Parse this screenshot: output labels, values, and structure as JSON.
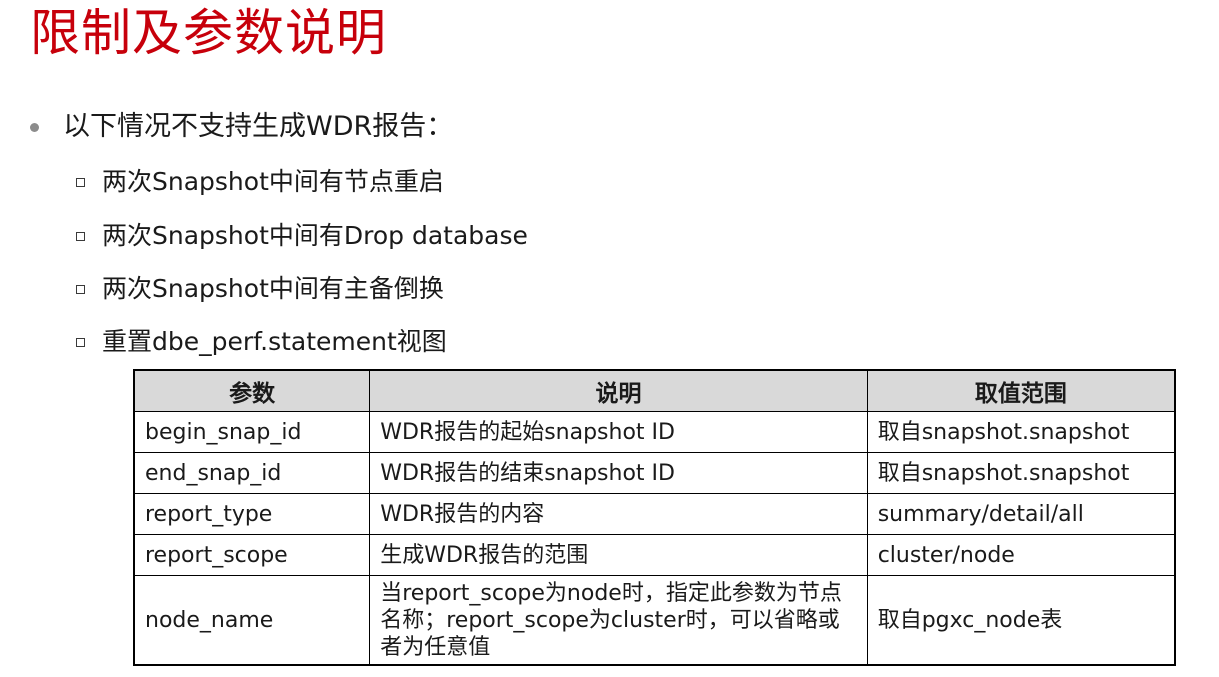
{
  "title": "限制及参数说明",
  "main_bullet": "以下情况不支持生成WDR报告：",
  "sub_bullets": [
    "两次Snapshot中间有节点重启",
    "两次Snapshot中间有Drop database",
    "两次Snapshot中间有主备倒换",
    "重置dbe_perf.statement视图"
  ],
  "table": {
    "headers": [
      "参数",
      "说明",
      "取值范围"
    ],
    "rows": [
      [
        "begin_snap_id",
        "WDR报告的起始snapshot ID",
        "取自snapshot.snapshot"
      ],
      [
        "end_snap_id",
        "WDR报告的结束snapshot ID",
        "取自snapshot.snapshot"
      ],
      [
        "report_type",
        "WDR报告的内容",
        "summary/detail/all"
      ],
      [
        "report_scope",
        "生成WDR报告的范围",
        "cluster/node"
      ],
      [
        "node_name",
        "当report_scope为node时，指定此参数为节点名称；report_scope为cluster时，可以省略或者为任意值",
        "取自pgxc_node表"
      ]
    ]
  },
  "colors": {
    "title": "#c7000b",
    "header_bg": "#d9d9d9"
  }
}
